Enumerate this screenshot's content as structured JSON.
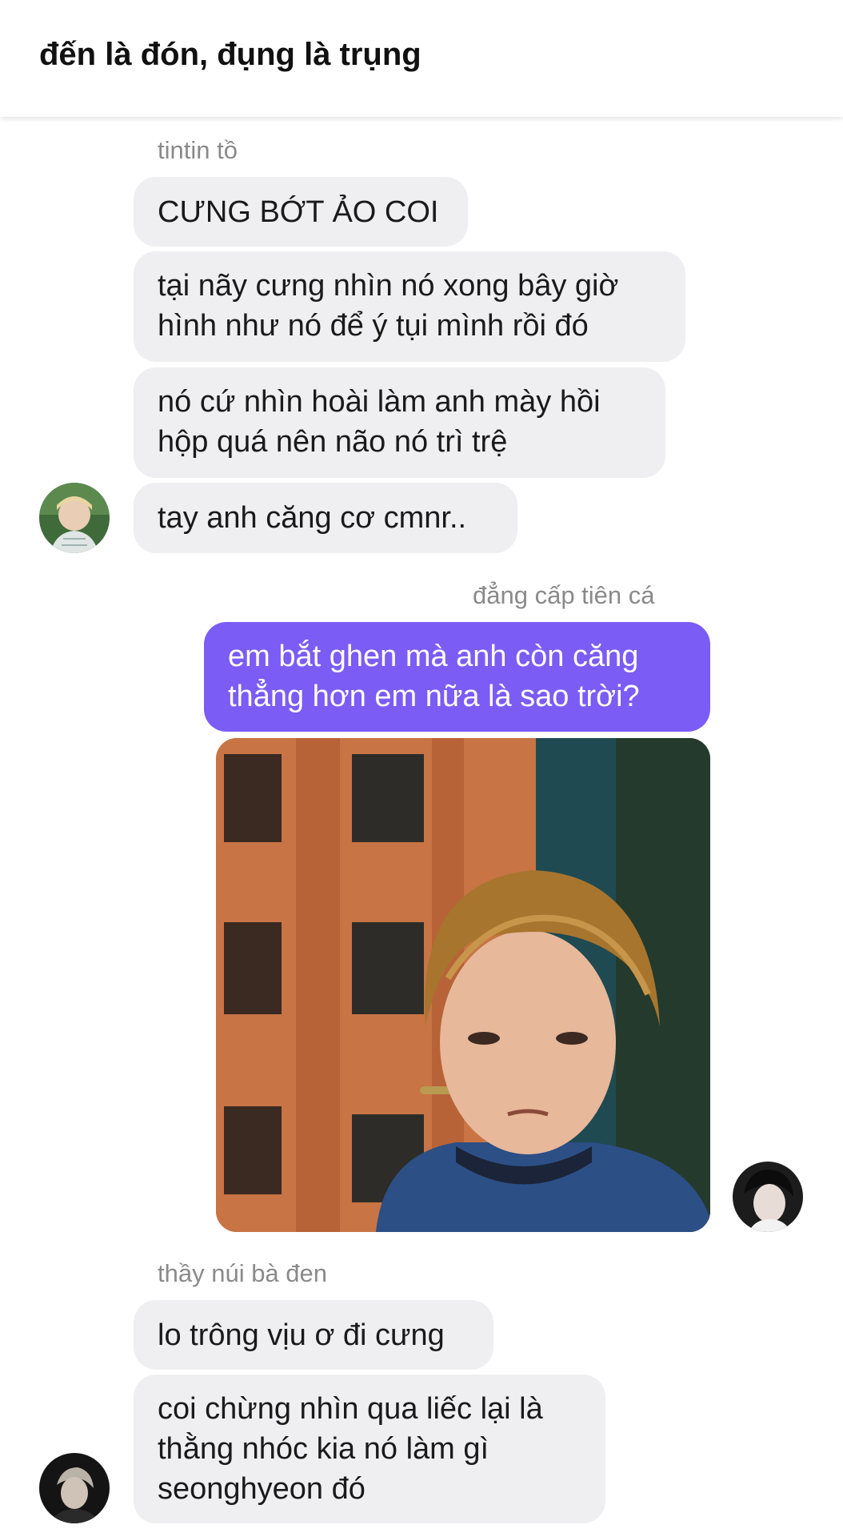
{
  "header": {
    "title": "đến là đón, đụng là trụng"
  },
  "messages": {
    "group1": {
      "sender": "tintin tồ",
      "msg1": "CƯNG BỚT ẢO COI",
      "msg2": "tại nãy cưng nhìn nó xong bây giờ hình như nó để ý tụi mình rồi đó",
      "msg3": "nó cứ nhìn hoài làm anh mày hồi hộp quá nên não nó trì trệ",
      "msg4": "tay anh căng cơ cmnr.."
    },
    "group2": {
      "sender": "đẳng cấp tiên cá",
      "msg1": "em bắt ghen mà anh còn căng thẳng hơn em nữa là sao trời?"
    },
    "group3": {
      "sender": "thầy núi bà đen",
      "msg1": "lo trông vịu ơ đi cưng",
      "msg2": "coi chừng nhìn qua liếc lại là thằng nhóc kia nó làm gì seonghyeon đó"
    }
  },
  "colors": {
    "my_bubble": "#7b5cf5",
    "their_bubble": "#efeff1",
    "sender_text": "#8a8a8a"
  }
}
